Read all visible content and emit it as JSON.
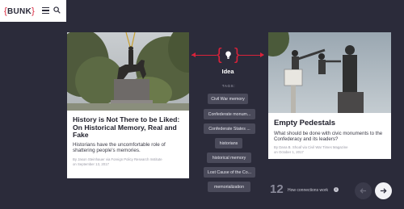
{
  "header": {
    "logo_text": "BUNK",
    "logo_brace_open": "{",
    "logo_brace_close": "}",
    "menu_icon": "hamburger-menu-icon",
    "search_icon": "search-icon"
  },
  "left_card": {
    "title": "History is Not There to be Liked: On Historical Memory, Real and Fake",
    "description": "Historians have the uncomfortable role of shattering people's memories.",
    "meta_line1": "By Jason Steinhauer via Foreign Policy Research Institute",
    "meta_line2": "on September 13, 2017"
  },
  "right_card": {
    "title": "Empty Pedestals",
    "description": "What should be done with civic monuments to the Confederacy and its leaders?",
    "meta_line1": "By Dana B. Shoaf via Civil War Times Magazine",
    "meta_line2": "on October 1, 2017"
  },
  "connection": {
    "brace_open": "{",
    "brace_close": "}",
    "icon": "lightbulb-icon",
    "label": "Idea",
    "tags_label": "TAGS:",
    "tags": [
      "Civil War memory",
      "Confederate monum...",
      "Confederate States ...",
      "historians",
      "historical memory",
      "Lost Cause of the Co...",
      "memorialization"
    ]
  },
  "footer": {
    "count": "12",
    "how_label": "How connections work",
    "info_icon": "info-icon",
    "prev_icon": "arrow-left-icon",
    "next_icon": "arrow-right-icon"
  },
  "colors": {
    "background": "#2b2b3a",
    "accent": "#d9223a",
    "tag_bg": "#4a4a5a",
    "card_bg": "#ffffff"
  }
}
